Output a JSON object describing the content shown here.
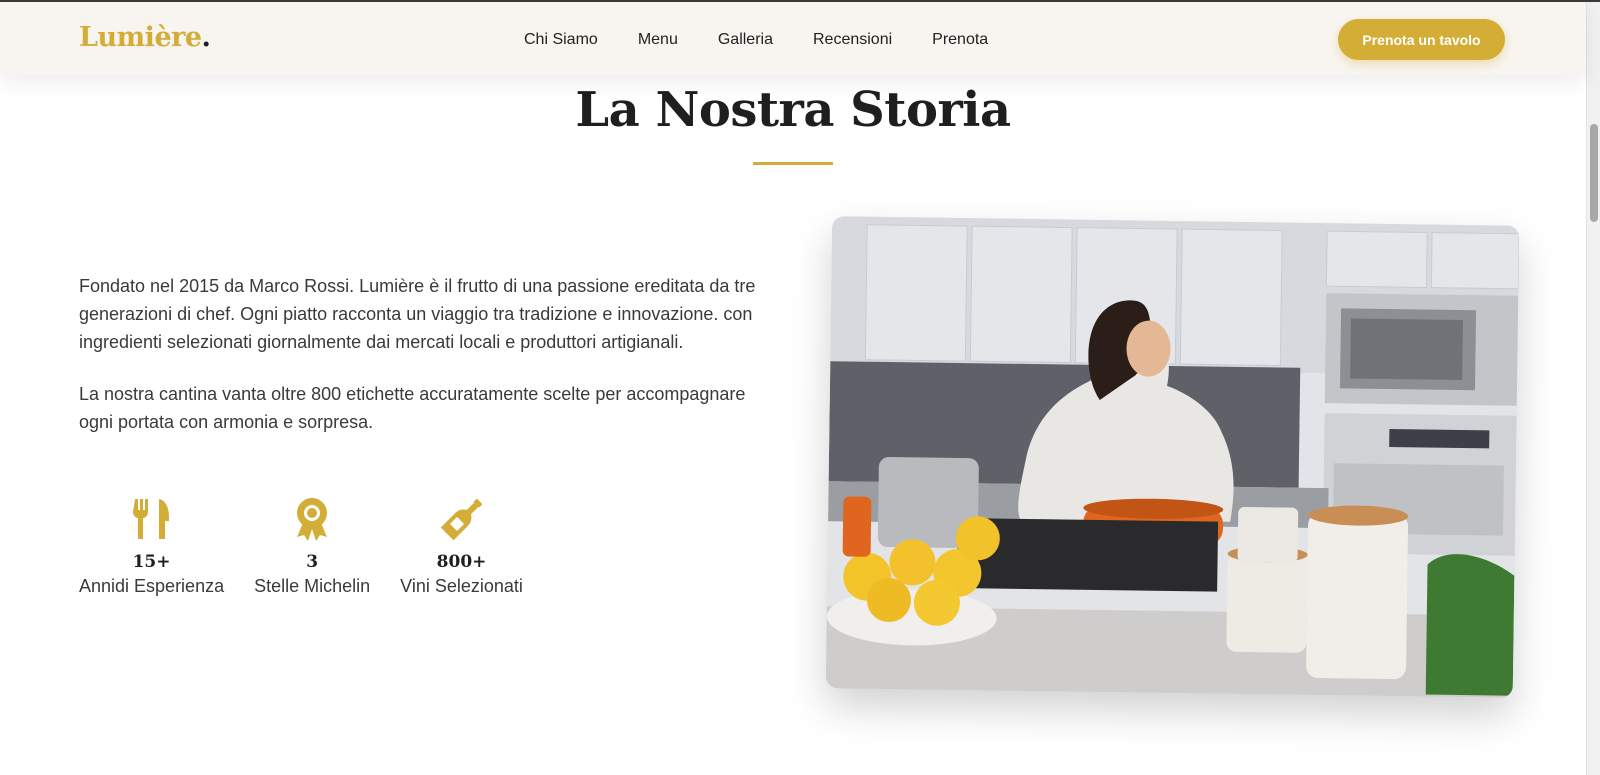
{
  "brand": {
    "name": "Lumière",
    "dot": ".",
    "accent": "#d4ad37"
  },
  "nav": {
    "links": [
      "Chi Siamo",
      "Menu",
      "Galleria",
      "Recensioni",
      "Prenota"
    ],
    "cta_label": "Prenota un tavolo"
  },
  "about": {
    "title": "La Nostra Storia",
    "paragraphs": [
      "Fondato nel 2015 da Marco Rossi. Lumière è il frutto di una passione ereditata da tre generazioni di chef. Ogni piatto racconta un viaggio tra tradizione e innovazione. con ingredienti selezionati giornalmente dai mercati locali e produttori artigianali.",
      "La nostra cantina vanta oltre 800 etichette accuratamente scelte per accompagnare ogni portata con armonia e sorpresa."
    ],
    "stats": [
      {
        "icon": "utensils-icon",
        "value": "15+",
        "label": "Annidi Esperienza"
      },
      {
        "icon": "award-icon",
        "value": "3",
        "label": "Stelle Michelin"
      },
      {
        "icon": "wine-bottle-icon",
        "value": "800+",
        "label": "Vini Selezionati"
      }
    ],
    "image": {
      "subject": "chef-cooking-photo"
    }
  }
}
